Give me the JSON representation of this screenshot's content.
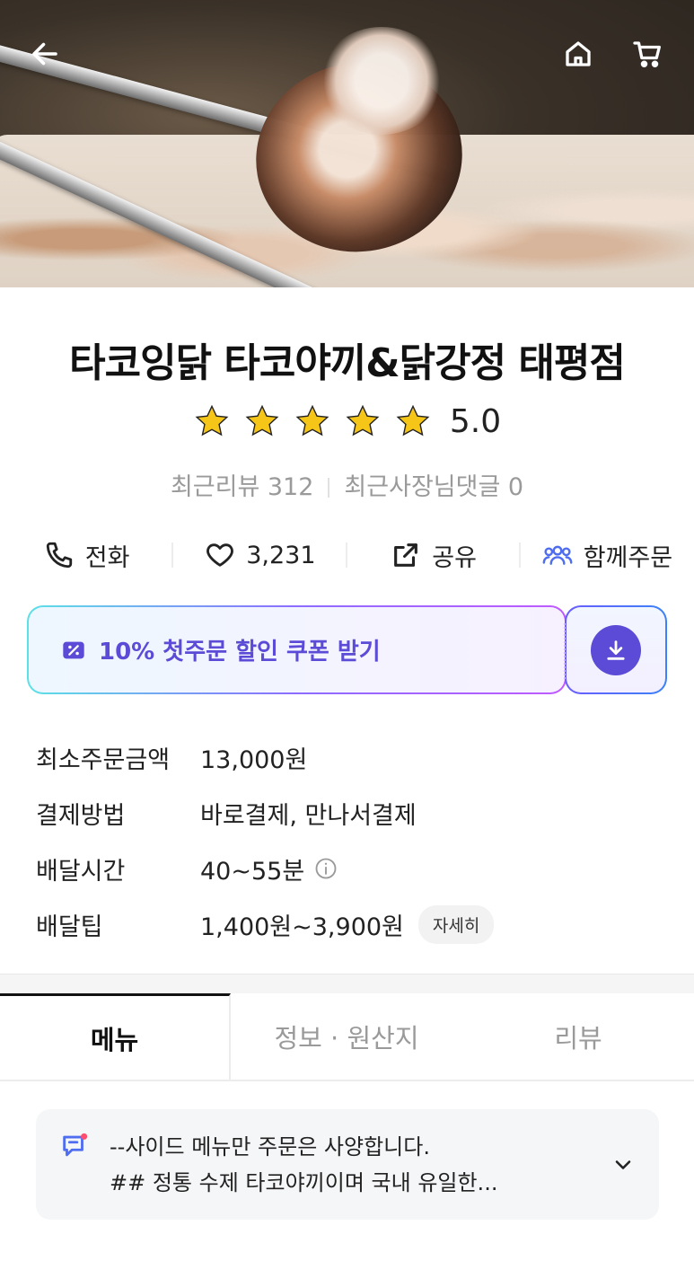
{
  "hero": {
    "image_alt": "takoyaki-with-bonito-flakes",
    "icons": [
      "back-arrow-icon",
      "home-icon",
      "cart-icon"
    ]
  },
  "store": {
    "name": "타코잉닭 타코야끼&닭강정 태평점",
    "rating": "5.0",
    "stars": 5,
    "recent_reviews": "최근리뷰 312",
    "owner_replies": "최근사장님댓글 0"
  },
  "actions": {
    "phone_label": "전화",
    "likes": "3,231",
    "share_label": "공유",
    "group_order_label": "함께주문"
  },
  "coupon": {
    "text": "10% 첫주문 할인 쿠폰 받기"
  },
  "info": [
    {
      "label": "최소주문금액",
      "value": "13,000원"
    },
    {
      "label": "결제방법",
      "value": "바로결제, 만나서결제"
    },
    {
      "label": "배달시간",
      "value": "40~55분"
    },
    {
      "label": "배달팁",
      "value": "1,400원~3,900원",
      "badge": "자세히"
    }
  ],
  "tabs": [
    {
      "label": "메뉴",
      "active": true
    },
    {
      "label": "정보 · 원산지",
      "active": false
    },
    {
      "label": "리뷰",
      "active": false
    }
  ],
  "notice": {
    "line1": "--사이드 메뉴만 주문은 사양합니다.",
    "line2": "## 정통 수제 타코야끼이며 국내 유일한..."
  },
  "colors": {
    "accent": "#5b4bd6",
    "star": "#f5c518",
    "group_icon": "#4f6df0"
  }
}
